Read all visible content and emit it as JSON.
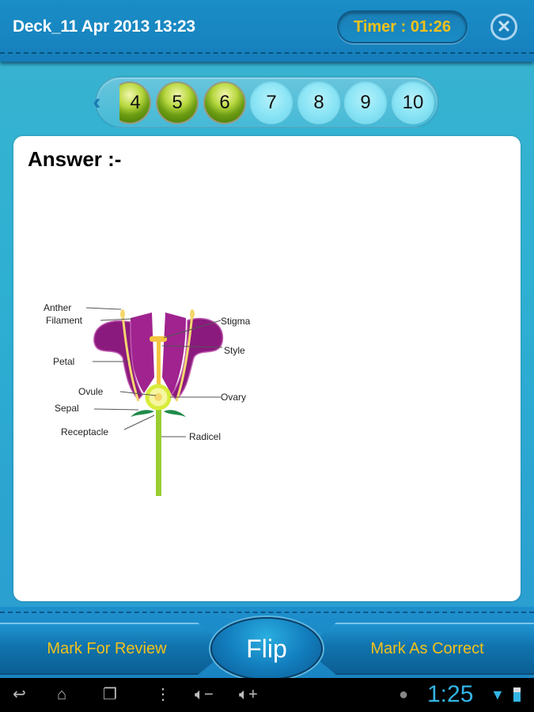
{
  "header": {
    "title": "Deck_11 Apr 2013 13:23",
    "timer": "Timer : 01:26",
    "close_icon": "close-circle-icon"
  },
  "pager": {
    "prev_icon": "double-chevron-left-icon",
    "items": [
      {
        "label": "4",
        "state": "answered"
      },
      {
        "label": "5",
        "state": "answered"
      },
      {
        "label": "6",
        "state": "answered"
      },
      {
        "label": "7",
        "state": "unanswered"
      },
      {
        "label": "8",
        "state": "unanswered"
      },
      {
        "label": "9",
        "state": "unanswered"
      },
      {
        "label": "10",
        "state": "unanswered"
      }
    ]
  },
  "card": {
    "heading": "Answer :-",
    "diagram": {
      "labels": {
        "anther": "Anther",
        "filament": "Filament",
        "petal": "Petal",
        "ovule": "Ovule",
        "sepal": "Sepal",
        "receptacle": "Receptacle",
        "stigma": "Stigma",
        "style": "Style",
        "ovary": "Ovary",
        "radicel": "Radicel"
      },
      "colors": {
        "petal": "#9c1e8c",
        "stamen": "#f5d76e",
        "ovary": "#d8ec3a",
        "stem": "#9acd32",
        "sepal": "#1e8a4a"
      }
    }
  },
  "actions": {
    "mark_review": "Mark For Review",
    "flip": "Flip",
    "mark_correct": "Mark As Correct"
  },
  "system_bar": {
    "back_icon": "back-icon",
    "home_icon": "home-icon",
    "recents_icon": "recent-apps-icon",
    "menu_icon": "menu-dots-icon",
    "vol_down_icon": "volume-down-icon",
    "vol_up_icon": "volume-up-icon",
    "android_icon": "android-icon",
    "time": "1:25",
    "wifi_icon": "wifi-icon",
    "battery_icon": "battery-icon"
  },
  "colors": {
    "accent_yellow": "#f2c21a",
    "header_blue": "#1784c0",
    "clock_blue": "#33b5e5"
  }
}
